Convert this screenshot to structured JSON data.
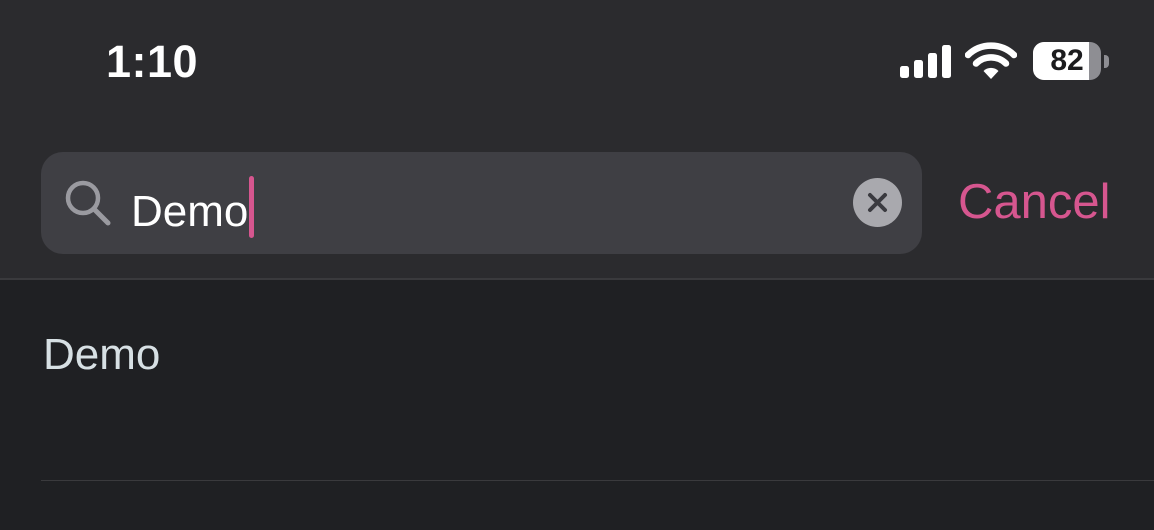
{
  "status_bar": {
    "time": "1:10",
    "battery_level": "82",
    "battery_fraction": 0.82,
    "icons": [
      "signal-icon",
      "wifi-icon",
      "battery-icon"
    ]
  },
  "search": {
    "value": "Demo",
    "icon": "search-icon",
    "clear_icon": "clear-icon",
    "cancel_label": "Cancel"
  },
  "results": [
    {
      "label": "Demo"
    }
  ],
  "colors": {
    "accent": "#d6568f",
    "background": "#1f2023",
    "header_background": "#2b2b2e",
    "search_field": "#3f3f44",
    "result_text": "#d7e0e4"
  }
}
